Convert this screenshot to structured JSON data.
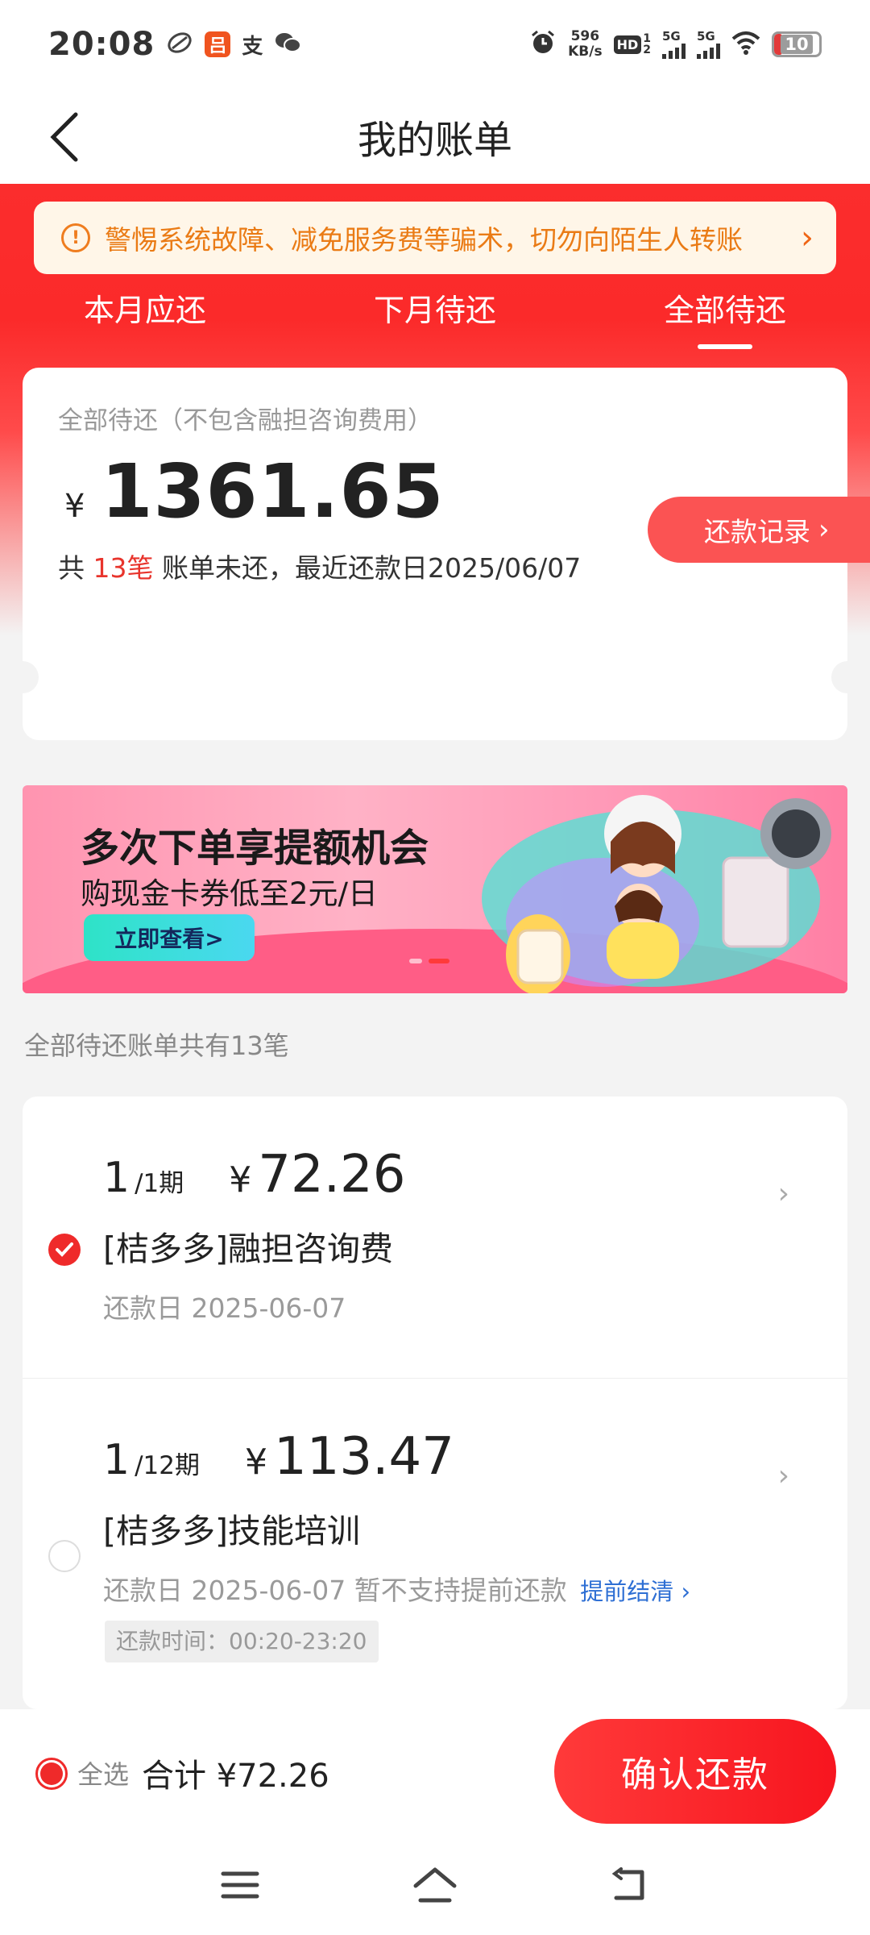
{
  "status_bar": {
    "time": "20:08",
    "net_speed_value": "596",
    "net_speed_unit": "KB/s",
    "sig1_label": "5G",
    "sig2_label": "5G",
    "battery": "10"
  },
  "nav": {
    "title": "我的账单"
  },
  "notice": {
    "text": "警惕系统故障、减免服务费等骗术，切勿向陌生人转账"
  },
  "tabs": [
    {
      "label": "本月应还",
      "active": false
    },
    {
      "label": "下月待还",
      "active": false
    },
    {
      "label": "全部待还",
      "active": true
    }
  ],
  "summary": {
    "label": "全部待还（不包含融担咨询费用）",
    "currency": "¥",
    "amount": "1361.65",
    "info_prefix": "共 ",
    "count": "13笔",
    "info_suffix": " 账单未还，最近还款日2025/06/07",
    "record_button": "还款记录"
  },
  "banner": {
    "title": "多次下单享提额机会",
    "subtitle": "购现金卡券低至2元/日",
    "button": "立即查看>"
  },
  "list_caption": "全部待还账单共有13笔",
  "bills": [
    {
      "period_num": "1",
      "period_total": "/1期",
      "currency": "¥",
      "amount": "72.26",
      "name": "[桔多多]融担咨询费",
      "date": "还款日 2025-06-07",
      "checked": true
    },
    {
      "period_num": "1",
      "period_total": "/12期",
      "currency": "¥",
      "amount": "113.47",
      "name": "[桔多多]技能培训",
      "date": "还款日 2025-06-07 暂不支持提前还款",
      "link": "提前结清",
      "time_tag": "还款时间：00:20-23:20",
      "checked": false
    }
  ],
  "bottom": {
    "select_all": "全选",
    "total": "合计 ¥72.26",
    "pay_button": "确认还款"
  },
  "colors": {
    "brand_red": "#fb2d2d",
    "notice_orange": "#ea7b15",
    "link_blue": "#2e6fd4"
  }
}
